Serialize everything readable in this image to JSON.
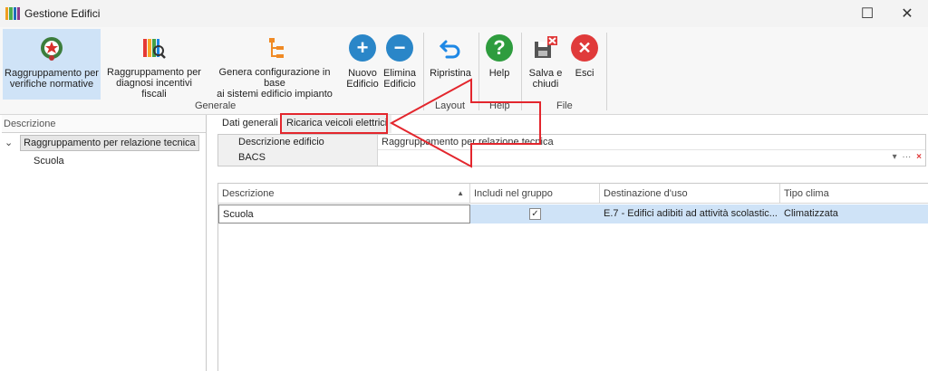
{
  "window": {
    "title": "Gestione Edifici",
    "minimize_glyph": "☐",
    "close_glyph": "✕"
  },
  "ribbon": {
    "buttons": [
      {
        "id": "raggr-verifiche",
        "line1": "Raggruppamento per",
        "line2": "verifiche normative",
        "icon": "emblem-icon"
      },
      {
        "id": "raggr-diagnosi",
        "line1": "Raggruppamento per",
        "line2": "diagnosi incentivi fiscali",
        "icon": "bars-magnifier-icon"
      },
      {
        "id": "genera-config",
        "line1": "Genera configurazione in base",
        "line2": "ai sistemi edificio impianto",
        "icon": "tree-structure-icon"
      },
      {
        "id": "nuovo-edificio",
        "line1": "Nuovo",
        "line2": "Edificio",
        "icon": "plus-circle-icon"
      },
      {
        "id": "elimina-edificio",
        "line1": "Elimina",
        "line2": "Edificio",
        "icon": "minus-circle-icon"
      },
      {
        "id": "ripristina",
        "line1": "Ripristina",
        "line2": "",
        "icon": "undo-arrow-icon"
      },
      {
        "id": "help",
        "line1": "Help",
        "line2": "",
        "icon": "question-circle-icon"
      },
      {
        "id": "salva-chiudi",
        "line1": "Salva e",
        "line2": "chiudi",
        "icon": "save-close-icon"
      },
      {
        "id": "esci",
        "line1": "Esci",
        "line2": "",
        "icon": "close-circle-icon"
      }
    ],
    "groups": {
      "generale": "Generale",
      "layout": "Layout",
      "help": "Help",
      "file": "File"
    }
  },
  "left_panel": {
    "header": "Descrizione",
    "tree": [
      {
        "label": "Raggruppamento per relazione tecnica",
        "expand_glyph": "✓"
      },
      {
        "label": "Scuola"
      }
    ]
  },
  "tabs": [
    {
      "label": "Dati generali"
    },
    {
      "label": "Ricarica veicoli elettrici"
    }
  ],
  "properties": [
    {
      "name": "Descrizione edificio",
      "value": "Raggruppamento per relazione tecnica"
    },
    {
      "name": "BACS",
      "value": ""
    }
  ],
  "bacs_controls": {
    "dropdown": "▾",
    "ellipsis": "···",
    "clear": "×"
  },
  "grid": {
    "columns": [
      "Descrizione",
      "Includi nel gruppo",
      "Destinazione d'uso",
      "Tipo clima"
    ],
    "sort_glyph": "▲",
    "rows": [
      {
        "descrizione": "Scuola",
        "includi": true,
        "check_glyph": "✓",
        "destinazione": "E.7 - Edifici adibiti ad attività scolastic...",
        "clima": "Climatizzata"
      }
    ]
  },
  "colors": {
    "selected": "#cfe3f7",
    "annotation": "#e3262d",
    "blue_btn": "#2a86c8",
    "green_btn": "#2e9c3e",
    "red_btn": "#e03a3a"
  }
}
